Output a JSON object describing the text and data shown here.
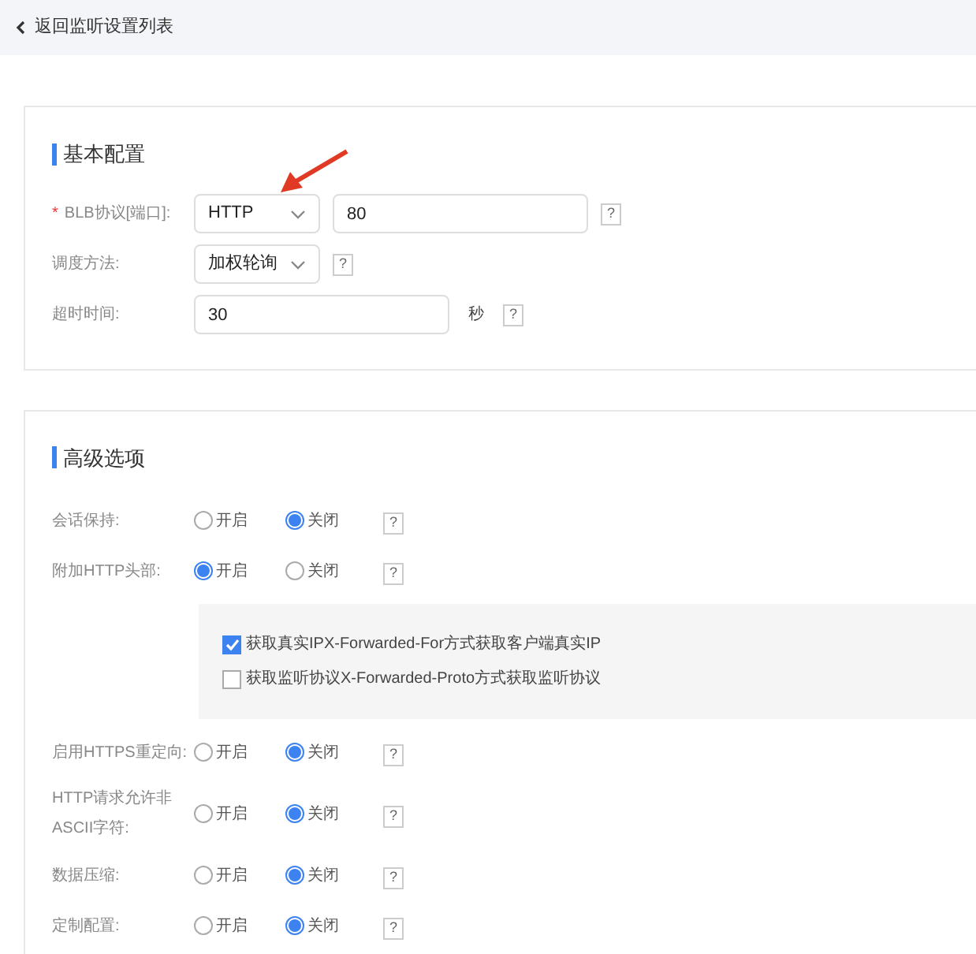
{
  "header": {
    "back_label": "返回监听设置列表"
  },
  "basic": {
    "title": "基本配置",
    "rows": [
      {
        "kind": "protocol",
        "label": "BLB协议[端口]:",
        "required_mark": "*",
        "select": "HTTP",
        "value": "80",
        "help": "?"
      },
      {
        "kind": "select",
        "label": "调度方法:",
        "select": "加权轮询",
        "help": "?"
      },
      {
        "kind": "input",
        "label": "超时时间:",
        "value": "30",
        "unit": "秒",
        "help": "?"
      }
    ]
  },
  "advanced": {
    "title": "高级选项",
    "rows": [
      {
        "kind": "radio",
        "label": "会话保持:",
        "options": [
          {
            "label": "开启",
            "selected": false
          },
          {
            "label": "关闭",
            "selected": true
          }
        ],
        "help": "?"
      },
      {
        "kind": "radio",
        "label": "附加HTTP头部:",
        "options": [
          {
            "label": "开启",
            "selected": true
          },
          {
            "label": "关闭",
            "selected": false
          }
        ],
        "help": "?"
      },
      {
        "kind": "checks",
        "items": [
          {
            "label": "获取真实IPX-Forwarded-For方式获取客户端真实IP",
            "checked": true
          },
          {
            "label": "获取监听协议X-Forwarded-Proto方式获取监听协议",
            "checked": false
          }
        ]
      },
      {
        "kind": "radio",
        "label": "启用HTTPS重定向:",
        "options": [
          {
            "label": "开启",
            "selected": false
          },
          {
            "label": "关闭",
            "selected": true
          }
        ],
        "help": "?"
      },
      {
        "kind": "radio",
        "label": "HTTP请求允许非ASCII字符:",
        "options": [
          {
            "label": "开启",
            "selected": false
          },
          {
            "label": "关闭",
            "selected": true
          }
        ],
        "help": "?"
      },
      {
        "kind": "radio",
        "label": "数据压缩:",
        "options": [
          {
            "label": "开启",
            "selected": false
          },
          {
            "label": "关闭",
            "selected": true
          }
        ],
        "help": "?"
      },
      {
        "kind": "radio",
        "label": "定制配置:",
        "options": [
          {
            "label": "开启",
            "selected": false
          },
          {
            "label": "关闭",
            "selected": true
          }
        ],
        "help": "?"
      }
    ]
  }
}
